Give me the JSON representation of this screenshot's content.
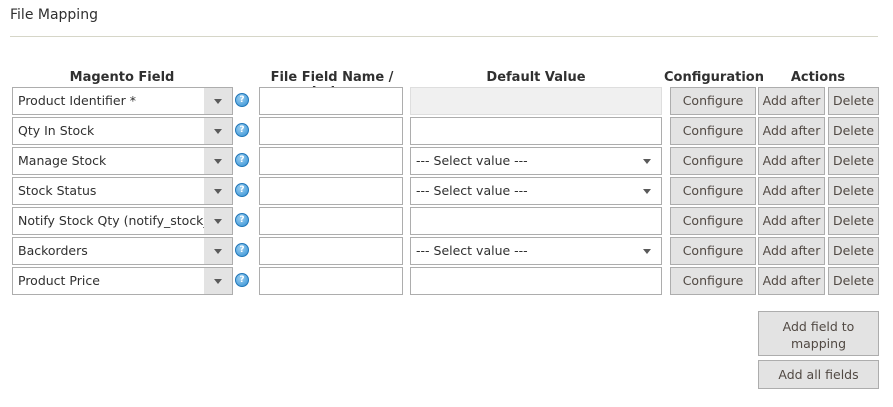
{
  "section": {
    "title": "File Mapping"
  },
  "columns": {
    "magento_field": "Magento Field",
    "file_field": "File Field Name / Index",
    "default_value": "Default Value",
    "configuration": "Configuration",
    "actions": "Actions"
  },
  "buttons": {
    "configure": "Configure",
    "add_after": "Add after",
    "delete": "Delete",
    "add_field": "Add field to mapping",
    "add_all": "Add all fields"
  },
  "rows": [
    {
      "field": "Product Identifier *",
      "file_field": "",
      "default_type": "disabled",
      "default_value": ""
    },
    {
      "field": "Qty In Stock",
      "file_field": "",
      "default_type": "text",
      "default_value": ""
    },
    {
      "field": "Manage Stock",
      "file_field": "",
      "default_type": "select",
      "default_value": "--- Select value ---"
    },
    {
      "field": "Stock Status",
      "file_field": "",
      "default_type": "select",
      "default_value": "--- Select value ---"
    },
    {
      "field": "Notify Stock Qty (notify_stock_qty)",
      "file_field": "",
      "default_type": "text",
      "default_value": ""
    },
    {
      "field": "Backorders",
      "file_field": "",
      "default_type": "select",
      "default_value": "--- Select value ---"
    },
    {
      "field": "Product Price",
      "file_field": "",
      "default_type": "text",
      "default_value": ""
    }
  ],
  "icons": {
    "help": "help-icon",
    "dropdown": "chevron-down-icon"
  },
  "colors": {
    "button_bg": "#e3e3e3",
    "help_blue": "#2f8fd4",
    "border": "#adadad"
  }
}
